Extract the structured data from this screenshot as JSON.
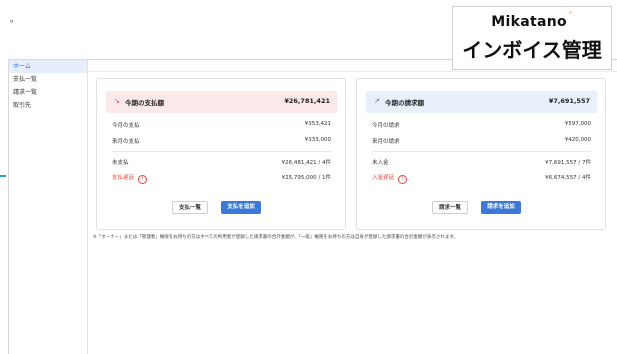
{
  "top_mark": "。",
  "brand": {
    "name_en": "Mikatano",
    "name_jp": "インボイス管理"
  },
  "sidebar": {
    "items": [
      {
        "label": "ホーム",
        "active": true
      },
      {
        "label": "支払一覧",
        "active": false
      },
      {
        "label": "請求一覧",
        "active": false
      },
      {
        "label": "取引先",
        "active": false
      }
    ]
  },
  "payments": {
    "title": "今期の支払額",
    "total": "¥26,781,421",
    "rows": [
      {
        "label": "今月の支払",
        "value": "¥353,421"
      },
      {
        "label": "来月の支払",
        "value": "¥333,000"
      },
      {
        "label": "未支払",
        "value": "¥26,481,421 / 4件"
      },
      {
        "label": "支払遅延",
        "value": "¥25,795,000 / 1件"
      }
    ],
    "btn_list": "支払一覧",
    "btn_add": "支払を追加"
  },
  "invoices": {
    "title": "今期の請求額",
    "total": "¥7,691,557",
    "rows": [
      {
        "label": "今月の請求",
        "value": "¥597,000"
      },
      {
        "label": "来月の請求",
        "value": "¥420,000"
      },
      {
        "label": "未入金",
        "value": "¥7,691,557 / 7件"
      },
      {
        "label": "入金遅延",
        "value": "¥6,674,557 / 4件"
      }
    ],
    "btn_list": "請求一覧",
    "btn_add": "請求を追加"
  },
  "note": "※「オーナー」または「管理者」権限をお持ちの方はすべての利用者が登録した請求書の合計金額が、「一般」権限をお持ちの方は自身が登録した請求書の合計金額が表示されます。",
  "colors": {
    "accent": "#3b78d8",
    "alert": "#e0443e",
    "pay_header": "#fbe9ea",
    "invoice_header": "#e8f0fb"
  }
}
